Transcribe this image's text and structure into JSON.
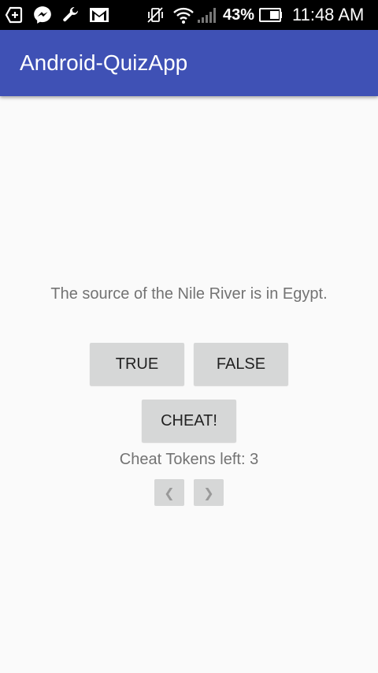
{
  "status_bar": {
    "icons": [
      "add-box-icon",
      "messenger-icon",
      "wrench-icon",
      "gmail-icon",
      "vibrate-off-icon",
      "wifi-icon",
      "signal-icon",
      "battery-icon"
    ],
    "battery_percent": "43%",
    "time": "11:48 AM"
  },
  "app_bar": {
    "title": "Android-QuizApp",
    "color": "#3f51b5"
  },
  "quiz": {
    "question": "The source of the Nile River is in Egypt.",
    "true_label": "TRUE",
    "false_label": "FALSE",
    "cheat_label": "CHEAT!",
    "cheat_tokens_text": "Cheat Tokens left: 3",
    "prev_glyph": "❮",
    "next_glyph": "❯"
  }
}
